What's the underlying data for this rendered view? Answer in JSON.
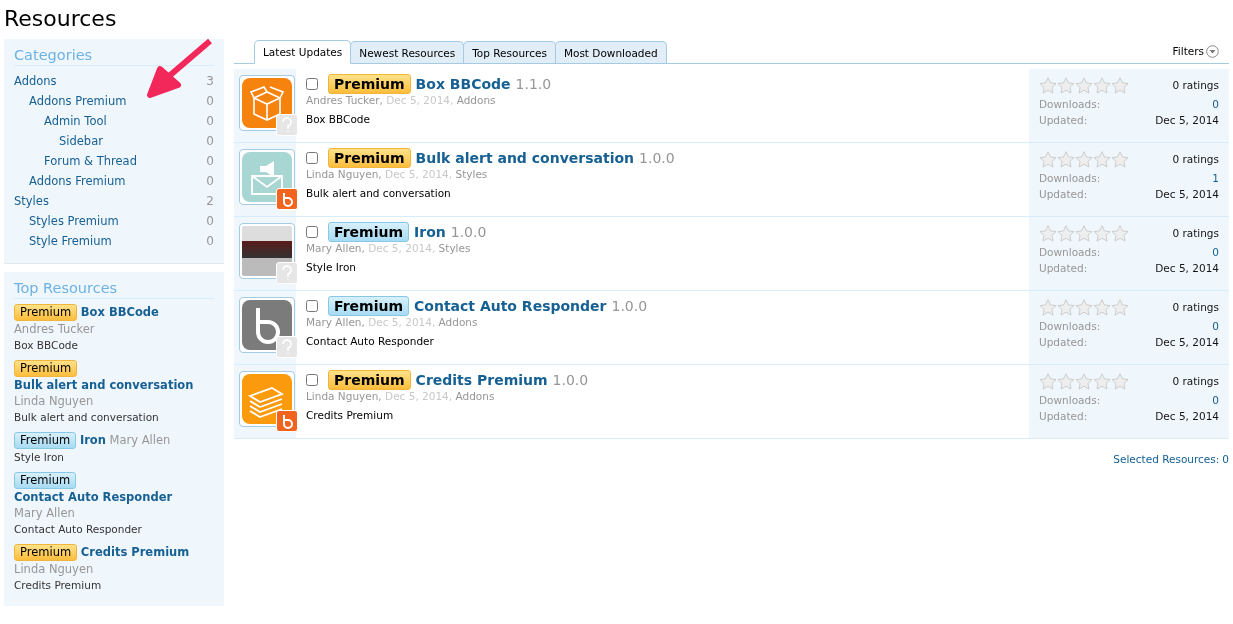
{
  "page_title": "Resources",
  "categories": {
    "title": "Categories",
    "items": [
      {
        "label": "Addons",
        "count": "3",
        "children": [
          {
            "label": "Addons Premium",
            "count": "0",
            "children": [
              {
                "label": "Admin Tool",
                "count": "0",
                "children": [
                  {
                    "label": "Sidebar",
                    "count": "0"
                  }
                ]
              },
              {
                "label": "Forum & Thread",
                "count": "0"
              }
            ]
          },
          {
            "label": "Addons Fremium",
            "count": "0"
          }
        ]
      },
      {
        "label": "Styles",
        "count": "2",
        "children": [
          {
            "label": "Styles Premium",
            "count": "0"
          },
          {
            "label": "Style Fremium",
            "count": "0"
          }
        ]
      }
    ]
  },
  "top_resources": {
    "title": "Top Resources",
    "items": [
      {
        "prefix": {
          "label": "Premium",
          "kind": "premium"
        },
        "title": "Box BBCode",
        "author": "Andres Tucker",
        "description": "Box BBCode"
      },
      {
        "prefix": {
          "label": "Premium",
          "kind": "premium"
        },
        "title": "Bulk alert and conversation",
        "author": "Linda Nguyen",
        "description": "Bulk alert and conversation"
      },
      {
        "prefix": {
          "label": "Fremium",
          "kind": "fremium"
        },
        "title": "Iron",
        "author": "Mary Allen",
        "description": "Style Iron"
      },
      {
        "prefix": {
          "label": "Fremium",
          "kind": "fremium"
        },
        "title": "Contact Auto Responder",
        "author": "Mary Allen",
        "description": "Contact Auto Responder"
      },
      {
        "prefix": {
          "label": "Premium",
          "kind": "premium"
        },
        "title": "Credits Premium",
        "author": "Linda Nguyen",
        "description": "Credits Premium"
      }
    ]
  },
  "tabs": [
    {
      "label": "Latest Updates",
      "selected": true
    },
    {
      "label": "Newest Resources",
      "selected": false
    },
    {
      "label": "Top Resources",
      "selected": false
    },
    {
      "label": "Most Downloaded",
      "selected": false
    }
  ],
  "filters": "Filters",
  "resources": [
    {
      "kind": "box",
      "badge": {
        "kind": "question"
      },
      "checked": false,
      "prefix": {
        "label": "Premium",
        "kind": "premium"
      },
      "title": "Box BBCode",
      "version": "1.1.0",
      "author": "Andres Tucker,",
      "date": "Dec 5, 2014,",
      "category": "Addons",
      "description": "Box BBCode",
      "stars": 0,
      "ratings": "0 ratings",
      "downloads_label": "Downloads:",
      "downloads": "0",
      "updated_label": "Updated:",
      "updated": "Dec 5, 2014"
    },
    {
      "kind": "megaphone",
      "badge": {
        "kind": "b"
      },
      "checked": false,
      "prefix": {
        "label": "Premium",
        "kind": "premium"
      },
      "title": "Bulk alert and conversation",
      "version": "1.0.0",
      "author": "Linda Nguyen,",
      "date": "Dec 5, 2014,",
      "category": "Styles",
      "description": "Bulk alert and conversation",
      "stars": 0,
      "ratings": "0 ratings",
      "downloads_label": "Downloads:",
      "downloads": "1",
      "updated_label": "Updated:",
      "updated": "Dec 5, 2014"
    },
    {
      "kind": "photo",
      "badge": {
        "kind": "question"
      },
      "checked": false,
      "prefix": {
        "label": "Fremium",
        "kind": "fremium"
      },
      "title": "Iron",
      "version": "1.0.0",
      "author": "Mary Allen,",
      "date": "Dec 5, 2014,",
      "category": "Styles",
      "description": "Style Iron",
      "stars": 0,
      "ratings": "0 ratings",
      "downloads_label": "Downloads:",
      "downloads": "0",
      "updated_label": "Updated:",
      "updated": "Dec 5, 2014"
    },
    {
      "kind": "b-logo",
      "badge": {
        "kind": "question"
      },
      "checked": false,
      "prefix": {
        "label": "Fremium",
        "kind": "fremium"
      },
      "title": "Contact Auto Responder",
      "version": "1.0.0",
      "author": "Mary Allen,",
      "date": "Dec 5, 2014,",
      "category": "Addons",
      "description": "Contact Auto Responder",
      "stars": 0,
      "ratings": "0 ratings",
      "downloads_label": "Downloads:",
      "downloads": "0",
      "updated_label": "Updated:",
      "updated": "Dec 5, 2014"
    },
    {
      "kind": "money",
      "badge": {
        "kind": "b"
      },
      "checked": false,
      "prefix": {
        "label": "Premium",
        "kind": "premium"
      },
      "title": "Credits Premium",
      "version": "1.0.0",
      "author": "Linda Nguyen,",
      "date": "Dec 5, 2014,",
      "category": "Addons",
      "description": "Credits Premium",
      "stars": 0,
      "ratings": "0 ratings",
      "downloads_label": "Downloads:",
      "downloads": "0",
      "updated_label": "Updated:",
      "updated": "Dec 5, 2014"
    }
  ],
  "selected_resources": {
    "label": "Selected Resources:",
    "count": "0"
  }
}
